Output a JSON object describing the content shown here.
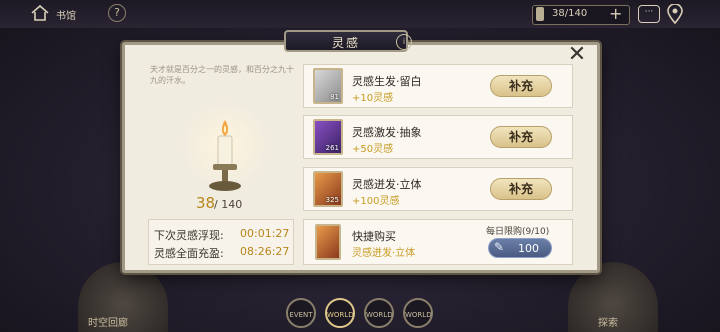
{
  "hud": {
    "title": "书馆",
    "help": "?",
    "resource": "38/140",
    "plus": "+",
    "chat": "···"
  },
  "bottom": {
    "left_label": "时空回廊",
    "right_label": "探索",
    "world_buttons": [
      "EVENT",
      "WORLD",
      "WORLD",
      "WORLD"
    ]
  },
  "modal": {
    "title": "灵感",
    "badge": "i",
    "close": "✕",
    "description": "天才就是百分之一的灵感，和百分之九十九的汗水。",
    "count_current": "38",
    "count_max": "/ 140",
    "next_label": "下次灵感浮现:",
    "next_value": "00:01:27",
    "full_label": "灵感全面充盈:",
    "full_value": "08:26:27",
    "items": [
      {
        "name": "灵感生发·留白",
        "gain": "+10灵感",
        "qty": "81",
        "button": "补充"
      },
      {
        "name": "灵感激发·抽象",
        "gain": "+50灵感",
        "qty": "261",
        "button": "补充"
      },
      {
        "name": "灵感迸发·立体",
        "gain": "+100灵感",
        "qty": "325",
        "button": "补充"
      }
    ],
    "quick_buy": {
      "name": "快捷购买",
      "subtitle": "灵感迸发·立体",
      "limit": "每日限购(9/10)",
      "price": "100"
    }
  },
  "colors": {
    "accent_gold": "#b8861c",
    "panel_bg": "#f1ece0"
  }
}
